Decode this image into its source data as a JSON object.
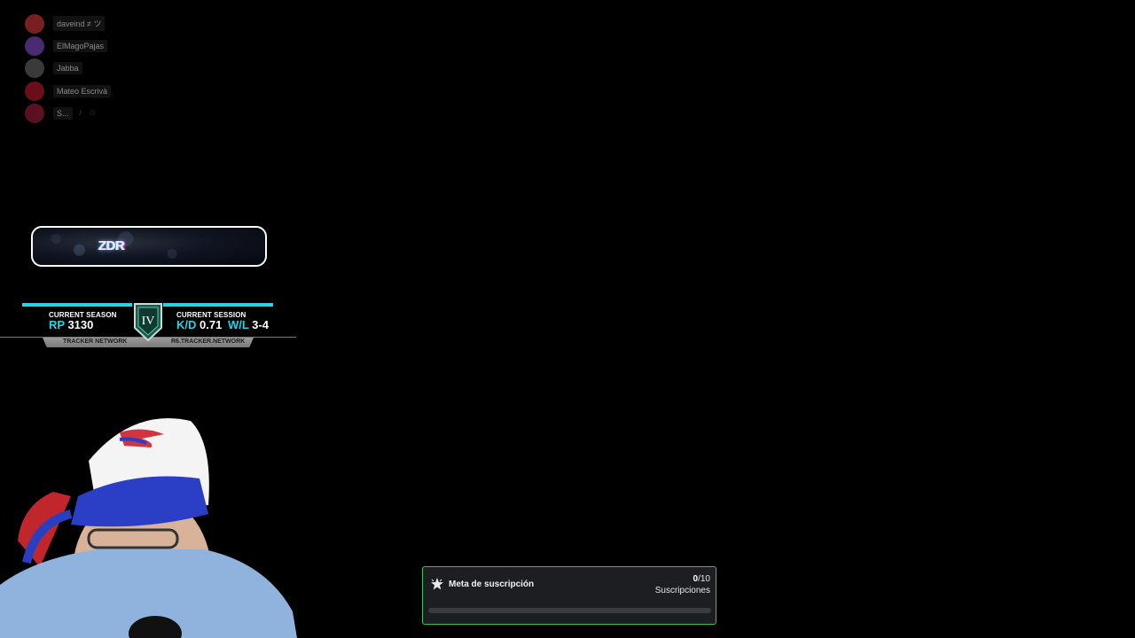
{
  "voice_chat": {
    "users": [
      {
        "name": "daveind ≠ ツ",
        "avatar_color": "#7a1f1f",
        "icon": "red-avatar-icon"
      },
      {
        "name": "ElMagoPajas",
        "avatar_color": "#4a2a70",
        "icon": "purple-avatar-icon"
      },
      {
        "name": "Jabba",
        "avatar_color": "#3a3a3a",
        "icon": "gray-avatar-icon"
      },
      {
        "name": "Mateo Escrivà",
        "avatar_color": "#6a0f1a",
        "icon": "crimson-avatar-icon"
      },
      {
        "name": "S...",
        "avatar_color": "#5a1020",
        "icon": "skull-avatar-icon",
        "extra": "♪ ☺"
      }
    ]
  },
  "name_banner": {
    "text": "ZDR"
  },
  "tracker": {
    "season_label": "CURRENT SEASON",
    "rp_label": "RP",
    "rp_value": "3130",
    "rank": "IV",
    "session_label": "CURRENT SESSION",
    "kd_label": "K/D",
    "kd_value": "0.71",
    "wl_label": "W/L",
    "wl_value": "3-4",
    "footer_left": "TRACKER NETWORK",
    "footer_right": "R6.TRACKER.NETWORK",
    "accent_color": "#27d4e6"
  },
  "sub_goal": {
    "title": "Meta de suscripción",
    "current": "0",
    "target": "/10",
    "unit": "Suscripciones",
    "progress": 0,
    "border_color": "#3fbf5a"
  }
}
